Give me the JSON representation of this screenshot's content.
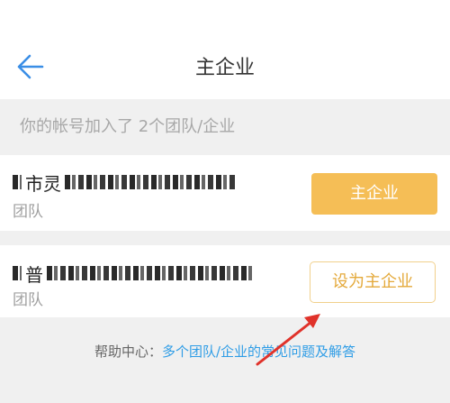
{
  "header": {
    "title": "主企业",
    "back_icon": "arrow-left-icon",
    "accent_color": "#3a8ee6"
  },
  "subtitle": "你的帐号加入了 2个团队/企业",
  "orgs": [
    {
      "name_visible": "市灵",
      "type": "团队",
      "action_label": "主企业",
      "action_color": "#f5be56"
    },
    {
      "name_visible": "普",
      "type": "团队",
      "action_label": "设为主企业",
      "action_color": "#e4a93a"
    }
  ],
  "help": {
    "label": "帮助中心：",
    "link": "多个团队/企业的常见问题及解答",
    "link_color": "#2f9de6"
  },
  "annotation": {
    "color": "#e0322a",
    "icon": "red-arrow-annotation"
  }
}
